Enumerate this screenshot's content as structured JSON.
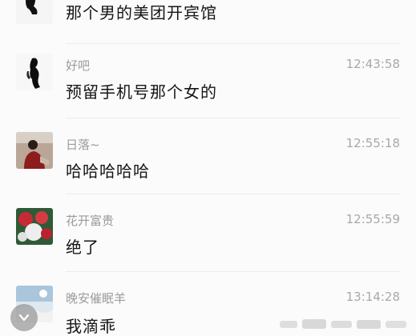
{
  "messages": [
    {
      "sender": "",
      "time": "",
      "text": "那个男的美团开宾馆"
    },
    {
      "sender": "好吧",
      "time": "12:43:58",
      "text": "预留手机号那个女的"
    },
    {
      "sender": "日落~",
      "time": "12:55:18",
      "text": "哈哈哈哈哈"
    },
    {
      "sender": "花开富贵",
      "time": "12:55:59",
      "text": "绝了"
    },
    {
      "sender": "晚安催眠羊",
      "time": "13:14:28",
      "text": "我滴乖"
    }
  ],
  "icons": {
    "back": "chevron-down-icon"
  },
  "colors": {
    "background": "#fbfbfb",
    "sender": "#9b9b9b",
    "time": "#a8a8a8",
    "text": "#151515",
    "divider": "#ececec"
  }
}
